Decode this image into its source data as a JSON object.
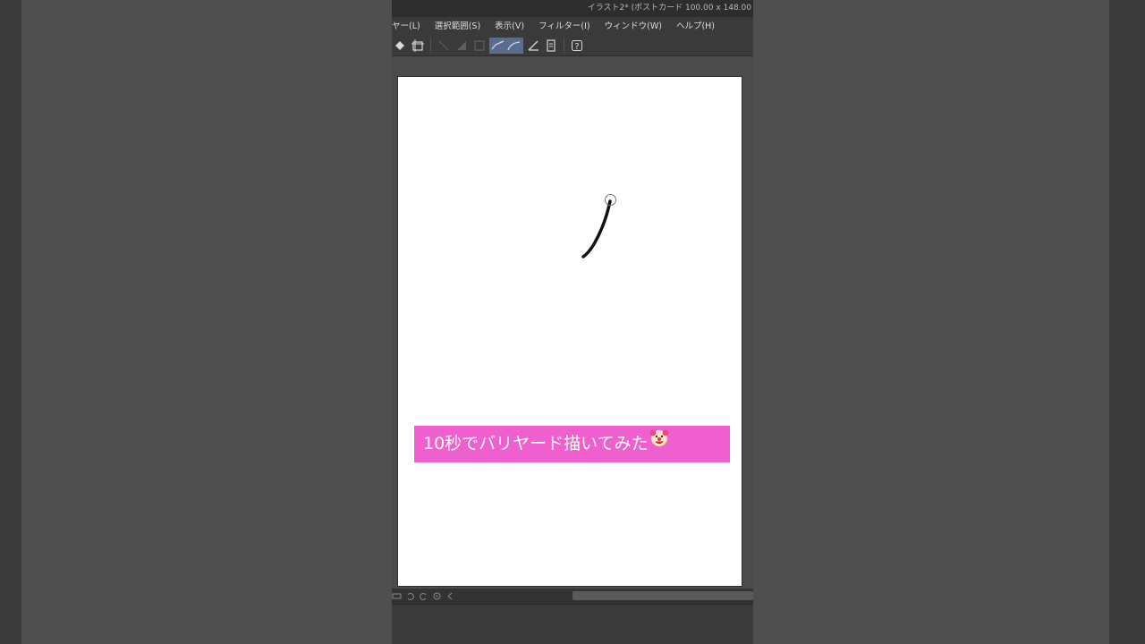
{
  "window": {
    "title": "イラスト2* (ポストカード 100.00 x 148.00"
  },
  "menu": {
    "items": [
      {
        "label": "ヤー(L)"
      },
      {
        "label": "選択範囲(S)"
      },
      {
        "label": "表示(V)"
      },
      {
        "label": "フィルター(I)"
      },
      {
        "label": "ウィンドウ(W)"
      },
      {
        "label": "ヘルプ(H)"
      }
    ]
  },
  "toolbar": {
    "icons": [
      "transform-icon",
      "selection-icon",
      "line-icon",
      "shade-icon",
      "frame-icon",
      "stabilizer-line-icon",
      "stabilizer-curve-icon",
      "ruler-icon",
      "page-icon",
      "help-icon"
    ]
  },
  "caption": {
    "text": "10秒でバリヤード描いてみた",
    "emoji": "clown-face-icon"
  },
  "colors": {
    "caption_bg": "#ef5fce",
    "caption_text": "#ffffff",
    "canvas": "#ffffff",
    "active_tool": "#5c6d8c"
  }
}
